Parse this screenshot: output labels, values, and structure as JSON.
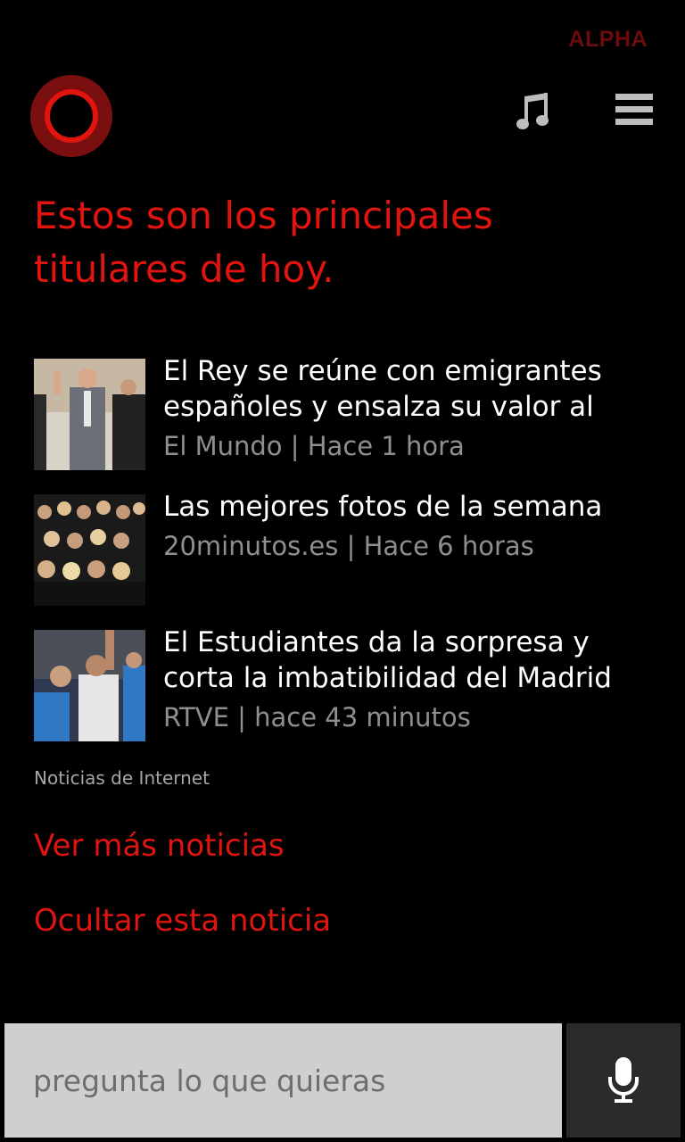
{
  "app": {
    "badge": "ALPHA"
  },
  "header": {
    "icons": [
      "cortana-logo",
      "music-note-icon",
      "hamburger-menu-icon"
    ]
  },
  "colors": {
    "accent": "#e1140f",
    "background": "#000000",
    "meta": "#8f8f8f",
    "search_bg": "#cfcfcf",
    "mic_bg": "#2b2b2b"
  },
  "headline": "Estos son los principales titulares de hoy.",
  "news": [
    {
      "title": "El Rey se reúne con emigrantes españoles y ensalza su valor al",
      "meta": "El Mundo | Hace 1 hora",
      "thumb": "king-meeting-photo"
    },
    {
      "title": "Las mejores fotos de la semana",
      "meta": "20minutos.es | Hace 6 horas",
      "thumb": "group-photo"
    },
    {
      "title": "El Estudiantes da la sorpresa y corta la imbatibilidad del Madrid",
      "meta": "RTVE | hace 43 minutos",
      "thumb": "basketball-photo"
    }
  ],
  "source_label": "Noticias de Internet",
  "links": {
    "more": "Ver más noticias",
    "hide": "Ocultar esta noticia"
  },
  "search": {
    "placeholder": "pregunta lo que quieras"
  }
}
